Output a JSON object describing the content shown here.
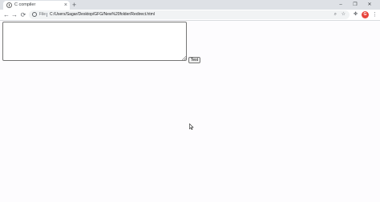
{
  "browser": {
    "tab": {
      "title": "C compiler",
      "close_glyph": "×",
      "favicon": "globe-icon"
    },
    "new_tab_glyph": "+",
    "window_controls": {
      "minimize": "–",
      "maximize": "❐",
      "close": "✕"
    },
    "toolbar": {
      "back_glyph": "←",
      "forward_glyph": "→",
      "reload_glyph": "⟳",
      "scheme_label": "File",
      "url": "C:/Users/Sagar/Desktop/GFG/New%20folder/Redirect.html",
      "zoom_glyph": "⌕",
      "star_glyph": "☆",
      "extensions_glyph": "✤",
      "profile_initial": "G",
      "menu_glyph": "⋮"
    },
    "colors": {
      "tabstrip": "#dee1e6",
      "profile": "#e8453c",
      "page_bg": "#fdfcfe"
    }
  },
  "page": {
    "textarea": {
      "value": "",
      "placeholder": ""
    },
    "test_button_label": "Test"
  }
}
